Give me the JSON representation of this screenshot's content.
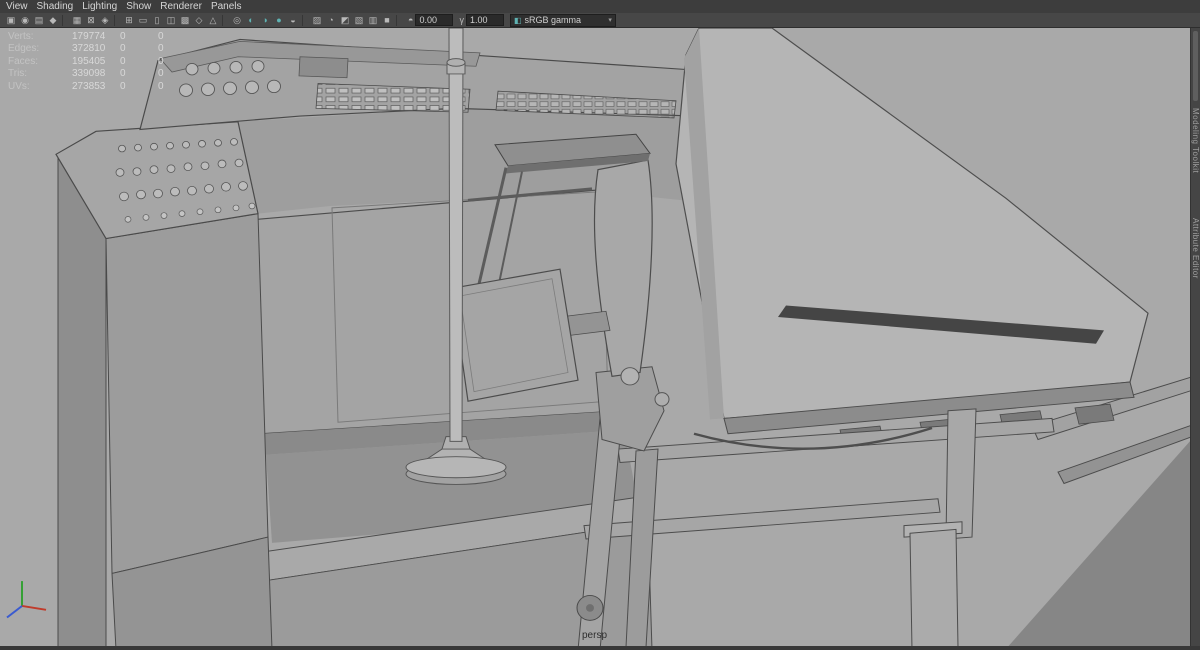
{
  "menu_bar": {
    "items": [
      "View",
      "Shading",
      "Lighting",
      "Show",
      "Renderer",
      "Panels"
    ]
  },
  "toolbar": {
    "icons": [
      {
        "name": "select-camera",
        "glyph": "▣"
      },
      {
        "name": "lock-camera",
        "glyph": "◉"
      },
      {
        "name": "camera-attributes",
        "glyph": "▤"
      },
      {
        "name": "bookmarks",
        "glyph": "◆"
      },
      {
        "name": "separator"
      },
      {
        "name": "image-plane",
        "glyph": "▦"
      },
      {
        "name": "2d-pan-zoom",
        "glyph": "⊠"
      },
      {
        "name": "grease-pencil",
        "glyph": "◈"
      },
      {
        "name": "separator"
      },
      {
        "name": "grid",
        "glyph": "⊞"
      },
      {
        "name": "film-gate",
        "glyph": "▭"
      },
      {
        "name": "resolution-gate",
        "glyph": "▯"
      },
      {
        "name": "gate-mask",
        "glyph": "◫"
      },
      {
        "name": "field-chart",
        "glyph": "▩"
      },
      {
        "name": "safe-action",
        "glyph": "◇"
      },
      {
        "name": "safe-title",
        "glyph": "△"
      },
      {
        "name": "separator"
      },
      {
        "name": "frame-all",
        "glyph": "◎"
      },
      {
        "name": "lighting",
        "glyph": "◐",
        "color": "#5fb3b3"
      },
      {
        "name": "shadows",
        "glyph": "◑",
        "color": "#5fb3b3"
      },
      {
        "name": "screen-space-ao",
        "glyph": "●",
        "color": "#5fb3b3"
      },
      {
        "name": "motion-blur",
        "glyph": "◒"
      },
      {
        "name": "separator"
      },
      {
        "name": "multisample-aa",
        "glyph": "▨"
      },
      {
        "name": "depth-of-field",
        "glyph": "◔"
      },
      {
        "name": "isolate-select",
        "glyph": "◩"
      },
      {
        "name": "xray",
        "glyph": "▧"
      },
      {
        "name": "wireframe-on-shaded",
        "glyph": "▥"
      },
      {
        "name": "use-default-material",
        "glyph": "■"
      },
      {
        "name": "separator"
      }
    ],
    "exposure_value": "0.00",
    "gamma_value": "1.00",
    "colorspace_value": "sRGB gamma"
  },
  "hud": {
    "rows": [
      {
        "label": "Verts:",
        "value": "179774",
        "sel": "0",
        "comp": "0"
      },
      {
        "label": "Edges:",
        "value": "372810",
        "sel": "0",
        "comp": "0"
      },
      {
        "label": "Faces:",
        "value": "195405",
        "sel": "0",
        "comp": "0"
      },
      {
        "label": "Tris:",
        "value": "339098",
        "sel": "0",
        "comp": "0"
      },
      {
        "label": "UVs:",
        "value": "273853",
        "sel": "0",
        "comp": "0"
      }
    ]
  },
  "viewport": {
    "camera_label": "persp"
  },
  "right_panel": {
    "tabs": [
      "Modeling Toolkit",
      "Attribute Editor"
    ]
  },
  "colors": {
    "accent_teal": "#5fb3b3",
    "axis_x": "#c03b2b",
    "axis_y": "#35a035",
    "axis_z": "#3a5bd0",
    "viewport_bg": "#a9a9a9",
    "ui_bar_bg": "#3d3d3d"
  }
}
